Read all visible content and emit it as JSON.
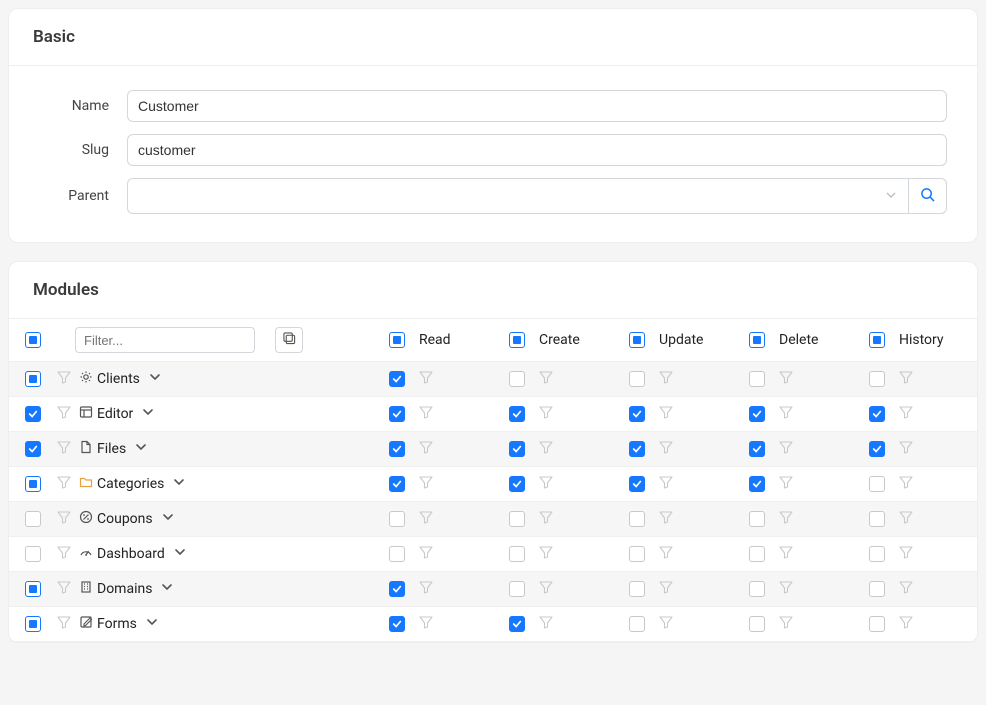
{
  "basic": {
    "title": "Basic",
    "fields": {
      "name_label": "Name",
      "name_value": "Customer",
      "slug_label": "Slug",
      "slug_value": "customer",
      "parent_label": "Parent",
      "parent_value": ""
    }
  },
  "modules": {
    "title": "Modules",
    "filter_placeholder": "Filter...",
    "header_checkbox_state": "indeterminate",
    "columns": [
      {
        "key": "read",
        "label": "Read",
        "state": "indeterminate"
      },
      {
        "key": "create",
        "label": "Create",
        "state": "indeterminate"
      },
      {
        "key": "update",
        "label": "Update",
        "state": "indeterminate"
      },
      {
        "key": "delete",
        "label": "Delete",
        "state": "indeterminate"
      },
      {
        "key": "history",
        "label": "History",
        "state": "indeterminate"
      }
    ],
    "rows": [
      {
        "icon": "gear",
        "label": "Clients",
        "row_state": "indeterminate",
        "perms": {
          "read": "checked",
          "create": "unchecked",
          "update": "unchecked",
          "delete": "unchecked",
          "history": "unchecked"
        }
      },
      {
        "icon": "layout",
        "label": "Editor",
        "row_state": "checked",
        "perms": {
          "read": "checked",
          "create": "checked",
          "update": "checked",
          "delete": "checked",
          "history": "checked"
        }
      },
      {
        "icon": "file",
        "label": "Files",
        "row_state": "checked",
        "perms": {
          "read": "checked",
          "create": "checked",
          "update": "checked",
          "delete": "checked",
          "history": "checked"
        }
      },
      {
        "icon": "folder",
        "label": "Categories",
        "row_state": "indeterminate",
        "perms": {
          "read": "checked",
          "create": "checked",
          "update": "checked",
          "delete": "checked",
          "history": "unchecked"
        }
      },
      {
        "icon": "percent",
        "label": "Coupons",
        "row_state": "unchecked",
        "perms": {
          "read": "unchecked",
          "create": "unchecked",
          "update": "unchecked",
          "delete": "unchecked",
          "history": "unchecked"
        }
      },
      {
        "icon": "gauge",
        "label": "Dashboard",
        "row_state": "unchecked",
        "perms": {
          "read": "unchecked",
          "create": "unchecked",
          "update": "unchecked",
          "delete": "unchecked",
          "history": "unchecked"
        }
      },
      {
        "icon": "building",
        "label": "Domains",
        "row_state": "indeterminate",
        "perms": {
          "read": "checked",
          "create": "unchecked",
          "update": "unchecked",
          "delete": "unchecked",
          "history": "unchecked"
        }
      },
      {
        "icon": "edit",
        "label": "Forms",
        "row_state": "indeterminate",
        "perms": {
          "read": "checked",
          "create": "checked",
          "update": "unchecked",
          "delete": "unchecked",
          "history": "unchecked"
        }
      }
    ]
  }
}
